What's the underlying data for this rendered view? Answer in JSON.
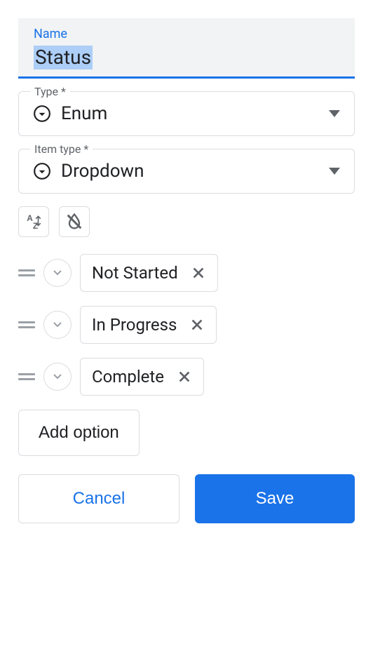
{
  "name": {
    "label": "Name",
    "value": "Status"
  },
  "type": {
    "label": "Type *",
    "value": "Enum"
  },
  "itemType": {
    "label": "Item type *",
    "value": "Dropdown"
  },
  "options": [
    {
      "label": "Not Started"
    },
    {
      "label": "In Progress"
    },
    {
      "label": "Complete"
    }
  ],
  "buttons": {
    "addOption": "Add option",
    "cancel": "Cancel",
    "save": "Save"
  }
}
